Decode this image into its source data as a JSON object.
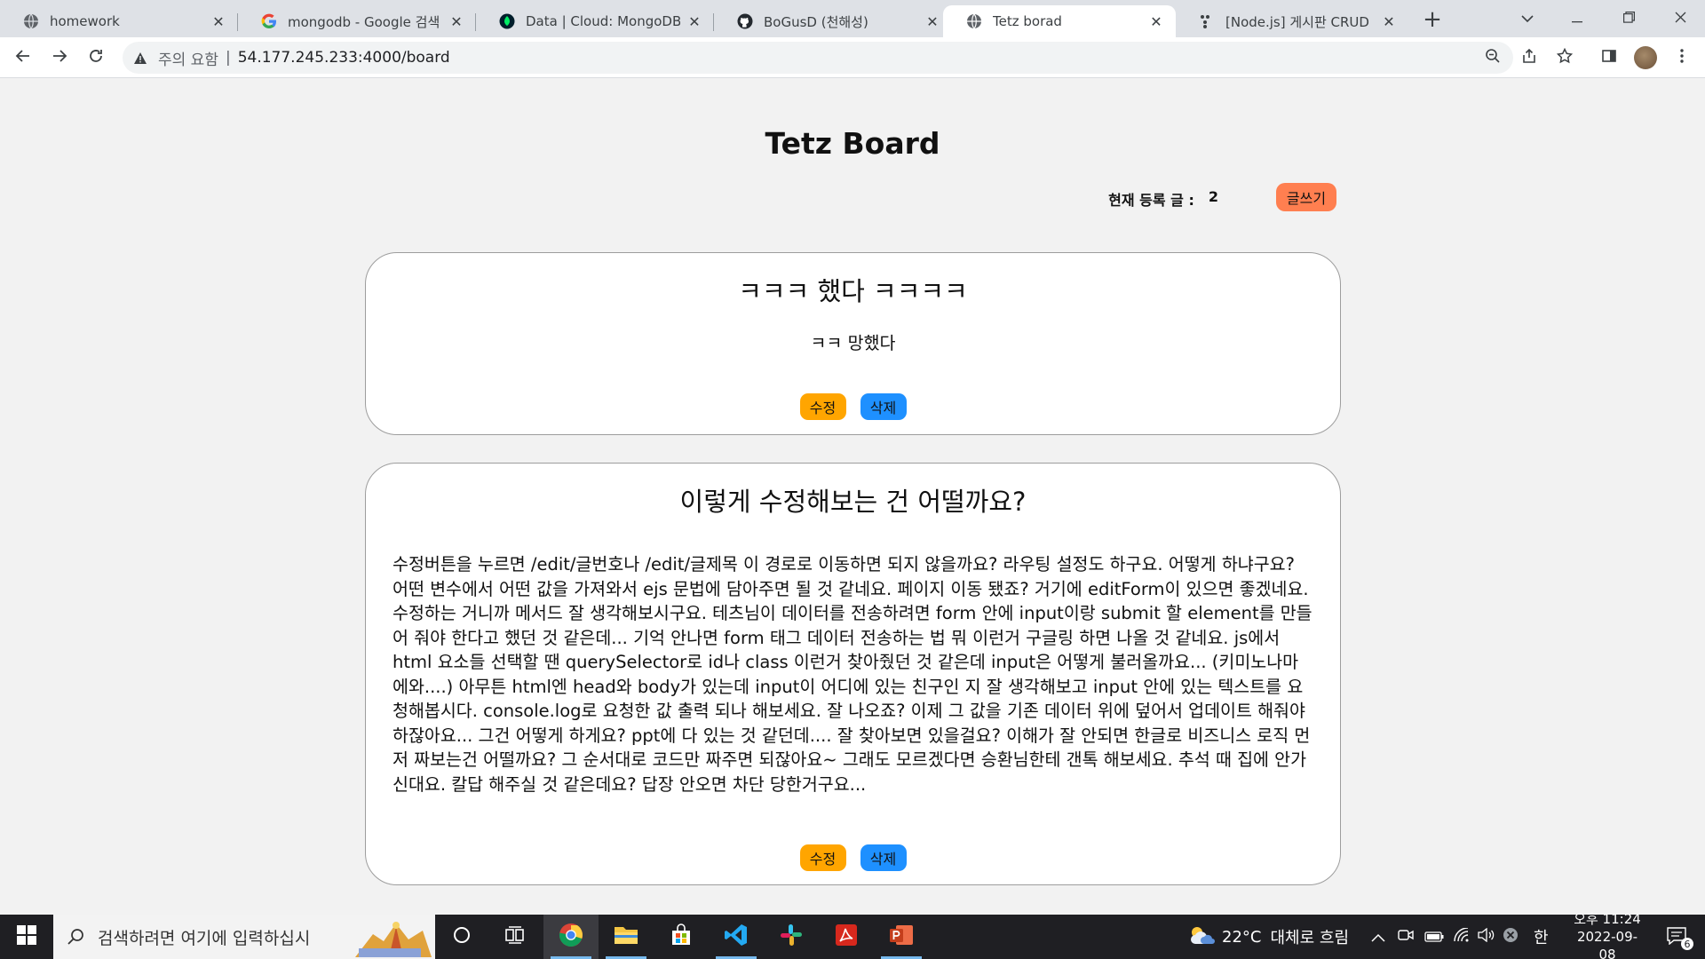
{
  "browser": {
    "tabs": [
      {
        "title": "homework",
        "icon": "globe-icon"
      },
      {
        "title": "mongodb - Google 검색",
        "icon": "google-icon"
      },
      {
        "title": "Data | Cloud: MongoDB Cl",
        "icon": "mongodb-leaf-icon"
      },
      {
        "title": "BoGusD (천해성)",
        "icon": "github-icon"
      },
      {
        "title": "Tetz borad",
        "icon": "globe-icon"
      },
      {
        "title": "[Node.js] 게시판 CRUD 만",
        "icon": "dots-icon"
      }
    ],
    "active_tab": 4,
    "omnibox": {
      "security_label": "주의 요함",
      "separator": "|",
      "url": "54.177.245.233:4000/board"
    }
  },
  "page": {
    "title": "Tetz Board",
    "count_label": "현재 등록 글 :",
    "count_value": "2",
    "write_label": "글쓰기",
    "posts": [
      {
        "title": "ㅋㅋㅋ 했다 ㅋㅋㅋㅋ",
        "body": "ㅋㅋ 망했다",
        "edit_label": "수정",
        "delete_label": "삭제"
      },
      {
        "title": "이렇게 수정해보는 건 어떨까요?",
        "body": "수정버튼을 누르면 /edit/글번호나 /edit/글제목 이 경로로 이동하면 되지 않을까요? 라우팅 설정도 하구요. 어떻게 하냐구요? 어떤 변수에서 어떤 값을 가져와서 ejs 문법에 담아주면 될 것 같네요. 페이지 이동 됐죠? 거기에 editForm이 있으면 좋겠네요. 수정하는 거니까 메서드 잘 생각해보시구요. 테츠님이 데이터를 전송하려면 form 안에 input이랑 submit 할 element를 만들어 줘야 한다고 했던 것 같은데... 기억 안나면 form 태그 데이터 전송하는 법 뭐 이런거 구글링 하면 나올 것 같네요. js에서 html 요소들 선택할 땐 querySelector로 id나 class 이런거 찾아줬던 것 같은데 input은 어떻게 불러올까요... (키미노나마에와....) 아무튼 html엔 head와 body가 있는데 input이 어디에 있는 친구인 지 잘 생각해보고 input 안에 있는 텍스트를 요청해봅시다. console.log로 요청한 값 출력 되나 해보세요. 잘 나오죠? 이제 그 값을 기존 데이터 위에 덮어서 업데이트 해줘야 하잖아요... 그건 어떻게 하게요? ppt에 다 있는 것 같던데.... 잘 찾아보면 있을걸요? 이해가 잘 안되면 한글로 비즈니스 로직 먼저 짜보는건 어떨까요? 그 순서대로 코드만 짜주면 되잖아요~ 그래도 모르겠다면 승환님한테 갠톡 해보세요. 추석 때 집에 안가신대요. 칼답 해주실 것 같은데요? 답장 안오면 차단 당한거구요...",
        "edit_label": "수정",
        "delete_label": "삭제"
      }
    ]
  },
  "taskbar": {
    "search_placeholder": "검색하려면 여기에 입력하십시",
    "weather_temp": "22°C",
    "weather_desc": "대체로 흐림",
    "ime": "한",
    "time": "오후 11:24",
    "date": "2022-09-08",
    "notification_count": "6"
  },
  "colors": {
    "write_button": "#ff7f50",
    "edit_button": "#ffa500",
    "delete_button": "#1e90ff",
    "page_bg": "#f2f2f2"
  }
}
